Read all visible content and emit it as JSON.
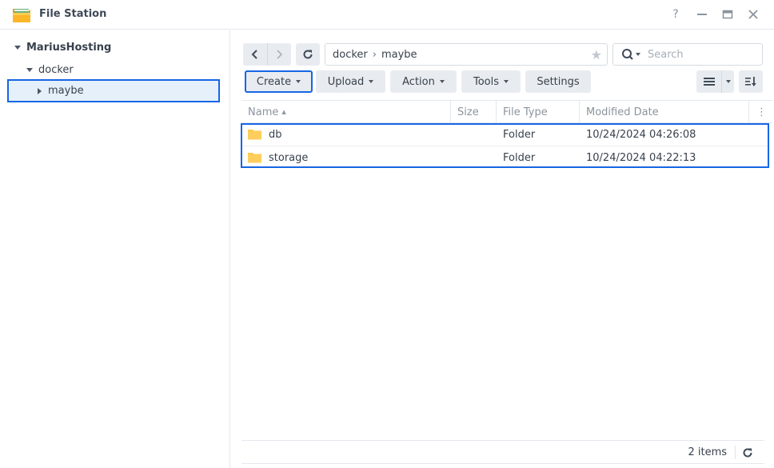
{
  "window": {
    "title": "File Station",
    "controls": {
      "help": "?",
      "minimize": "—",
      "maximize": "▭",
      "close": "✕"
    }
  },
  "sidebar": {
    "root": "MariusHosting",
    "items": [
      {
        "label": "docker",
        "expanded": true
      },
      {
        "label": "maybe",
        "expanded": false,
        "selected": true
      }
    ]
  },
  "navigation": {
    "back_icon": "chevron-left-icon",
    "forward_icon": "chevron-right-icon",
    "refresh_icon": "refresh-icon",
    "path": [
      "docker",
      "maybe"
    ],
    "path_separator": "›",
    "favorite_icon": "★",
    "search_placeholder": "Search"
  },
  "toolbar": {
    "create": "Create",
    "upload": "Upload",
    "action": "Action",
    "tools": "Tools",
    "settings": "Settings"
  },
  "table": {
    "columns": {
      "name": "Name",
      "name_sort": "▲",
      "size": "Size",
      "file_type": "File Type",
      "modified": "Modified Date",
      "more": "⋮"
    },
    "rows": [
      {
        "name": "db",
        "size": "",
        "type": "Folder",
        "modified": "10/24/2024 04:26:08"
      },
      {
        "name": "storage",
        "size": "",
        "type": "Folder",
        "modified": "10/24/2024 04:22:13"
      }
    ]
  },
  "footer": {
    "count": "2 items"
  },
  "colors": {
    "accent": "#1666e5",
    "folder": "#fdc94a",
    "button_bg": "#e8ecf0"
  }
}
